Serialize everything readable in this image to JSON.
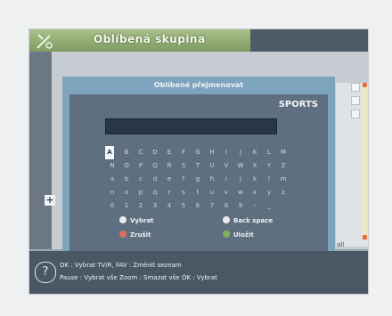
{
  "title": "Oblíbená skupina",
  "dialog": {
    "title": "Oblíbené přejmenovat",
    "group_name": "SPORTS",
    "input_value": ""
  },
  "keyboard": {
    "rows": [
      [
        "A",
        "B",
        "C",
        "D",
        "E",
        "F",
        "G",
        "H",
        "I",
        "J",
        "K",
        "L",
        "M"
      ],
      [
        "N",
        "O",
        "P",
        "Q",
        "R",
        "S",
        "T",
        "U",
        "V",
        "W",
        "X",
        "Y",
        "Z"
      ],
      [
        "a",
        "b",
        "c",
        "d",
        "e",
        "f",
        "g",
        "h",
        "i",
        "j",
        "k",
        "l",
        "m"
      ],
      [
        "n",
        "o",
        "p",
        "q",
        "r",
        "s",
        "t",
        "u",
        "v",
        "w",
        "x",
        "y",
        "z"
      ],
      [
        "0",
        "1",
        "2",
        "3",
        "4",
        "5",
        "6",
        "7",
        "8",
        "9",
        "-",
        "_",
        ""
      ]
    ],
    "selected": "A"
  },
  "legend": {
    "select": "Vybrat",
    "backspace": "Back space",
    "cancel": "Zrušit",
    "save": "Uložit"
  },
  "help": {
    "line1": "OK : Vybrat     TV/R, FAV : Změnit seznam",
    "line2": "Pause : Vybrat vše   Zoom : Smazat vše   OK : Vybrat"
  },
  "side": {
    "plus": "+",
    "right_text": "all"
  },
  "colors": {
    "title_green": "#8fab73",
    "scroll_marker": "#e36b3c",
    "dialog_blue": "#7da3bd"
  },
  "icons": [
    "satellite-icon",
    "plus-icon",
    "help-icon",
    "list-icon"
  ]
}
